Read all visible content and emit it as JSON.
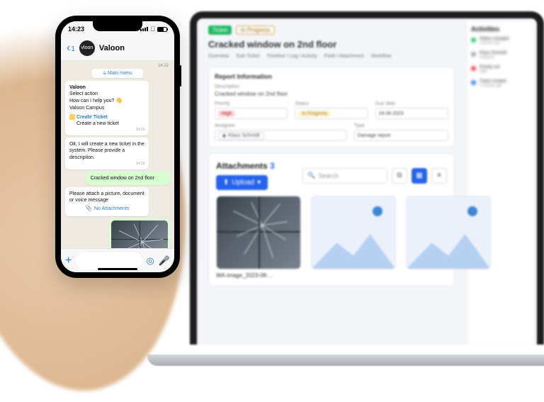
{
  "phone": {
    "time": "14:23",
    "back_count": "1",
    "contact": "Valoon",
    "avatar_text": "vloon",
    "menu_label": "Main menu",
    "ts_top": "14:22",
    "bubbles": {
      "welcome": {
        "name": "Valoon",
        "line1": "Select action",
        "line2": "How can I help you?",
        "line3": "Valoon Campus",
        "ts": "14:22"
      },
      "create": {
        "label": "Create Ticket",
        "sub": "Create a new ticket"
      },
      "ack": {
        "text": "Ok, I will create a new ticket in the system. Please provide a description.",
        "ts": "14:22"
      },
      "user_desc": {
        "text": "Cracked window on 2nd floor"
      },
      "attach_prompt": {
        "text": "Please attach a picture, document or voice message",
        "no_attach": "No Attachments"
      }
    }
  },
  "laptop": {
    "badge_ticket": "Ticket",
    "badge_status": "In Progress",
    "title": "Cracked window on 2nd floor",
    "tabs": [
      "Overview",
      "Sub-Ticket",
      "Timeline / Log / Activity",
      "Field / Attachment",
      "Workflow"
    ],
    "report_card": {
      "title": "Report Information",
      "description_label": "Description",
      "description_value": "Cracked window on 2nd floor",
      "fields": {
        "priority": {
          "label": "Priority",
          "value": "High"
        },
        "status": {
          "label": "Status",
          "value": "In Progress"
        },
        "due": {
          "label": "Due date",
          "value": "24.08.2023"
        },
        "assignee": {
          "label": "Assignee",
          "value": "Klaus Schmidt"
        },
        "type": {
          "label": "Type",
          "value": "Damage report"
        }
      }
    },
    "attachments": {
      "title": "Attachments",
      "count": "3",
      "upload_label": "Upload",
      "search_placeholder": "Search",
      "caption1": "WA-image_2023-08-..."
    },
    "activities_title": "Activities",
    "activities": [
      {
        "dot": "green",
        "l1": "Status changed",
        "l2": "a minute ago"
      },
      {
        "dot": "gray",
        "l1": "Klaus Schmidt",
        "l2": "assigned"
      },
      {
        "dot": "red",
        "l1": "Priority set",
        "l2": "High"
      },
      {
        "dot": "blue",
        "l1": "Ticket created",
        "l2": "2 minutes ago"
      }
    ]
  }
}
